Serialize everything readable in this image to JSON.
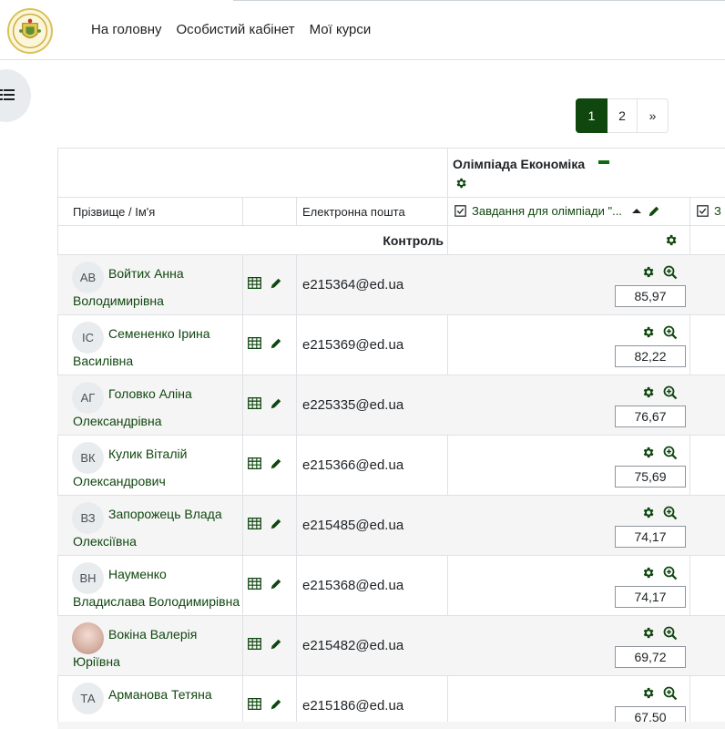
{
  "nav": {
    "home": "На головну",
    "cabinet": "Особистий кабінет",
    "courses": "Мої курси"
  },
  "pagination": {
    "current": "1",
    "next_page": "2",
    "next": "»"
  },
  "table": {
    "category_title": "Олімпіада Економіка",
    "col_name": "Прізвище / Ім'я",
    "col_email": "Електронна пошта",
    "col_task": "Завдання для олімпіади \"...",
    "col_task2": "З",
    "control_label": "Контроль"
  },
  "students": [
    {
      "initials": "АВ",
      "name_line1": "Войтих Анна",
      "name_line2": "Володимирівна",
      "email": "e215364@ed.ua",
      "grade": "85,97"
    },
    {
      "initials": "ІС",
      "name_line1": "Семененко Ірина",
      "name_line2": "Василівна",
      "email": "e215369@ed.ua",
      "grade": "82,22"
    },
    {
      "initials": "АГ",
      "name_line1": "Головко Аліна",
      "name_line2": "Олександрівна",
      "email": "e225335@ed.ua",
      "grade": "76,67"
    },
    {
      "initials": "ВК",
      "name_line1": "Кулик Віталій",
      "name_line2": "Олександрович",
      "email": "e215366@ed.ua",
      "grade": "75,69"
    },
    {
      "initials": "ВЗ",
      "name_line1": "Запорожець Влада",
      "name_line2": "Олексіївна",
      "email": "e215485@ed.ua",
      "grade": "74,17"
    },
    {
      "initials": "ВН",
      "name_line1": "Науменко",
      "name_line2": "Владислава Володимирівна",
      "email": "e215368@ed.ua",
      "grade": "74,17"
    },
    {
      "initials": "",
      "name_line1": "Вокіна Валерія",
      "name_line2": "Юріївна",
      "email": "e215482@ed.ua",
      "grade": "69,72"
    },
    {
      "initials": "ТА",
      "name_line1": "Арманова Тетяна",
      "name_line2": "",
      "email": "e215186@ed.ua",
      "grade": "67,50"
    }
  ],
  "icons": {
    "drawer": "list-icon",
    "settings": "gear-icon",
    "zoom": "zoom-in-icon",
    "grid": "table-icon",
    "edit": "pencil-icon",
    "sort": "sort-up-icon",
    "checkbox": "checkbox-icon"
  },
  "colors": {
    "brand": "#0f470f",
    "accent_icon": "#0f6b0f"
  }
}
